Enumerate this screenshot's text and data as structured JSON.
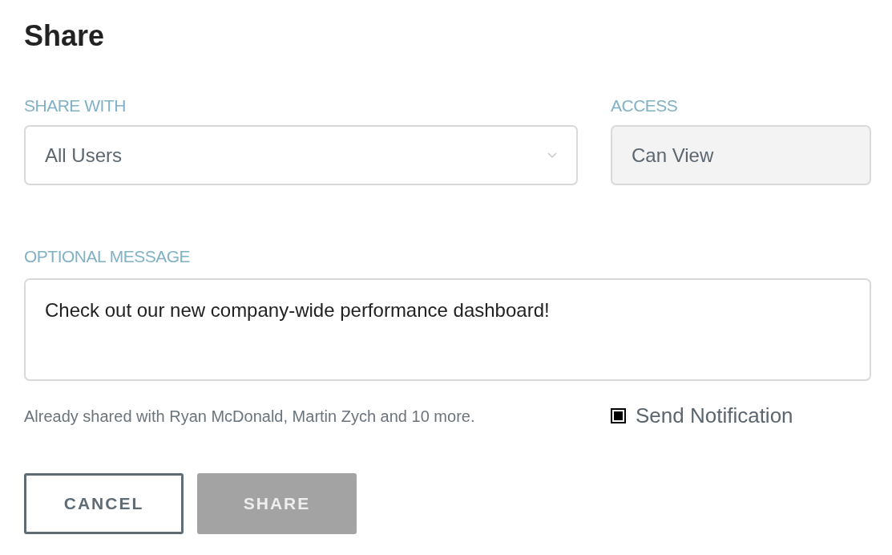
{
  "title": "Share",
  "share_with": {
    "label": "SHARE WITH",
    "value": "All Users"
  },
  "access": {
    "label": "ACCESS",
    "value": "Can View",
    "disabled": true
  },
  "message": {
    "label": "OPTIONAL MESSAGE",
    "value": "Check out our new company-wide performance dashboard!"
  },
  "already_shared": "Already shared with Ryan McDonald, Martin Zych and 10 more.",
  "notification": {
    "label": "Send Notification",
    "checked": true
  },
  "buttons": [
    {
      "label": "CANCEL",
      "kind": "outline",
      "disabled": false
    },
    {
      "label": "SHARE",
      "kind": "primary",
      "disabled": true
    }
  ]
}
